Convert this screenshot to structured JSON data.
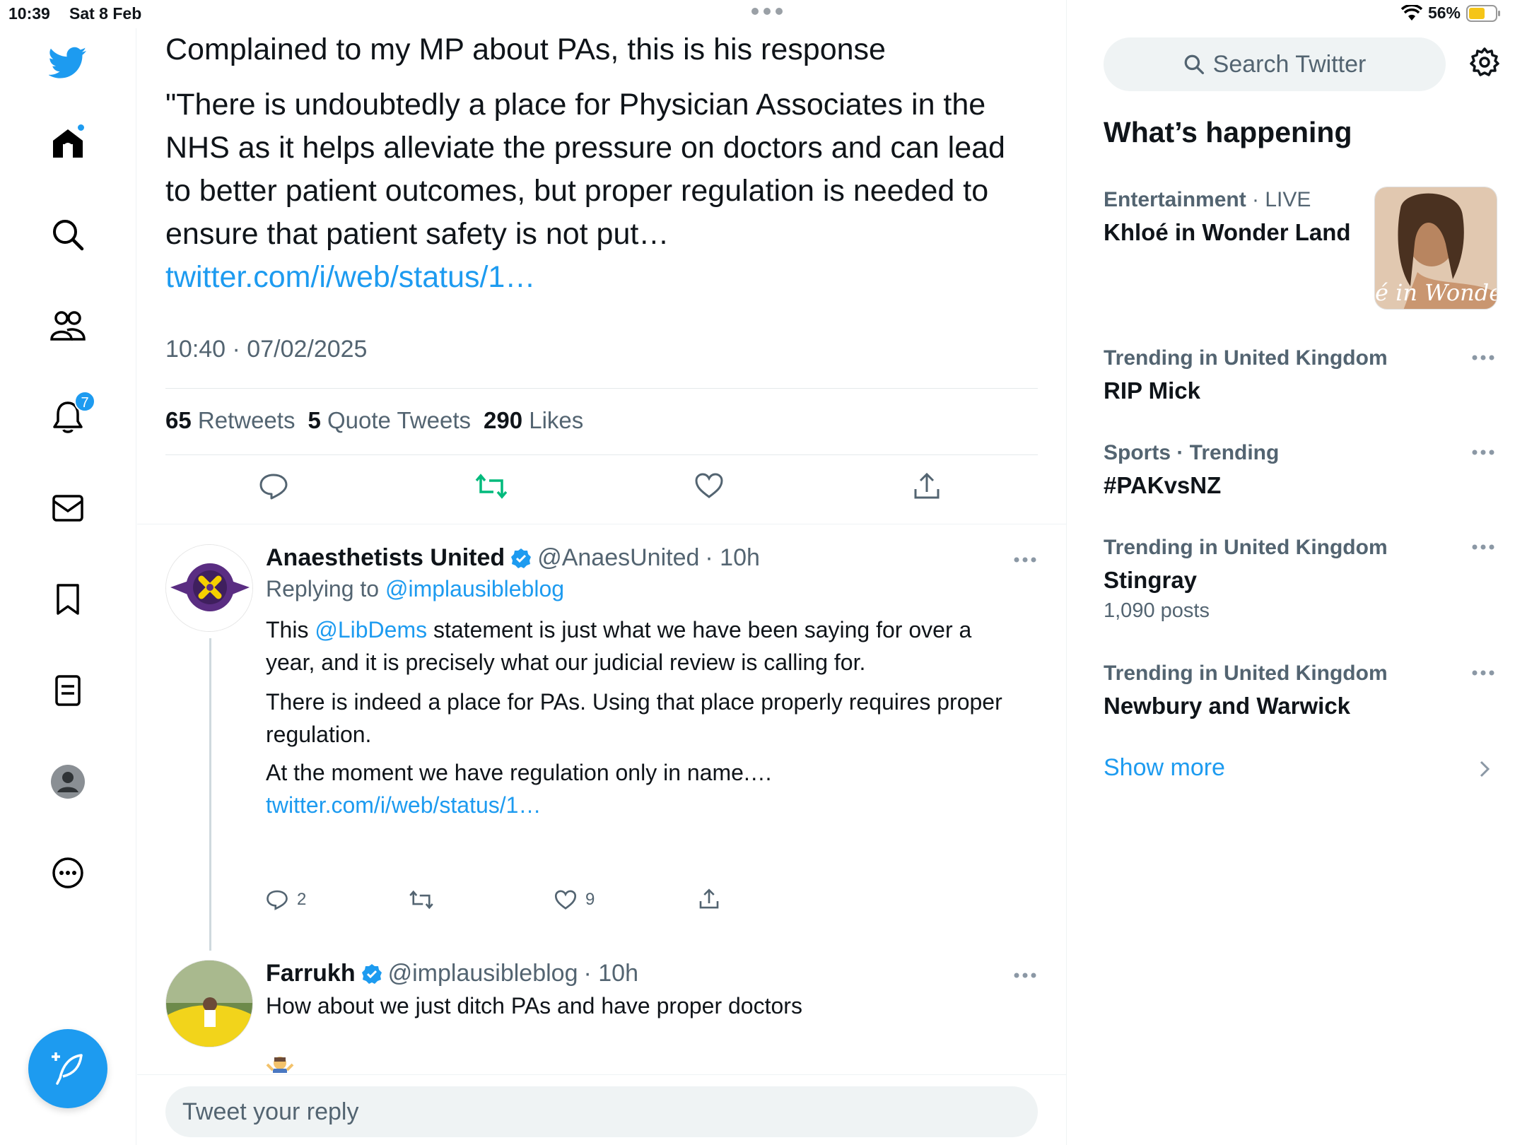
{
  "status_bar": {
    "time": "10:39",
    "date": "Sat 8 Feb",
    "battery": "56%"
  },
  "nav": {
    "notifications_badge": "7"
  },
  "tweet": {
    "title_line": "Complained to my MP about PAs, this is his response",
    "body": "\"There is undoubtedly a place for Physician Associates in the NHS as it helps alleviate the pressure on doctors and can lead to better patient outcomes, but proper regulation is needed to ensure that patient safety is not put…",
    "link": "twitter.com/i/web/status/1…",
    "timestamp": "10:40 · 07/02/2025",
    "stats": {
      "retweets_count": "65",
      "retweets_label": "Retweets",
      "quotes_count": "5",
      "quotes_label": "Quote Tweets",
      "likes_count": "290",
      "likes_label": "Likes"
    }
  },
  "replies": [
    {
      "name": "Anaesthetists United",
      "handle": "@AnaesUnited",
      "time": "· 10h",
      "replying_prefix": "Replying to ",
      "replying_to": "@implausibleblog",
      "mention": "@LibDems",
      "text_a": " statement is just what we have been saying for over a year, and it is precisely what our judicial review is calling for.",
      "text_prefix": "This ",
      "text_b": "There is indeed a place for PAs.  Using that place properly requires proper regulation.",
      "text_c": "At the moment we have regulation only in name.… ",
      "link": "twitter.com/i/web/status/1…",
      "reply_count": "2",
      "like_count": "9"
    },
    {
      "name": "Farrukh",
      "handle": "@implausibleblog",
      "time": "· 10h",
      "text": "How about we just ditch PAs and have proper doctors"
    }
  ],
  "reply_box": {
    "placeholder": "Tweet your reply"
  },
  "sidebar": {
    "search_placeholder": "Search Twitter",
    "section_title": "What’s happening",
    "trends": [
      {
        "category": "Entertainment",
        "live": "· LIVE",
        "title": "Khloé in Wonder Land",
        "image_caption": "é in Wonder L"
      },
      {
        "category": "Trending in United Kingdom",
        "title": "RIP Mick"
      },
      {
        "category": "Sports · Trending",
        "title": "#PAKvsNZ"
      },
      {
        "category": "Trending in United Kingdom",
        "title": "Stingray",
        "posts": "1,090 posts"
      },
      {
        "category": "Trending in United Kingdom",
        "title": "Newbury and Warwick"
      }
    ],
    "show_more": "Show more"
  },
  "colors": {
    "accent": "#1d9bf0",
    "retweet_active": "#00ba7c",
    "muted_text": "#536471"
  }
}
